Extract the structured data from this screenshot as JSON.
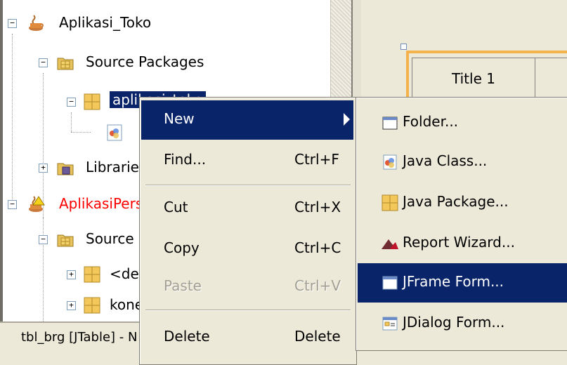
{
  "tree": {
    "items": [
      {
        "label": "Aplikasi_Toko",
        "expander": "−"
      },
      {
        "label": "Source Packages",
        "expander": "−"
      },
      {
        "label": "aplikasi_toko",
        "expander": "−"
      },
      {
        "label": "",
        "expander": ""
      },
      {
        "label": "Libraries",
        "expander": "+"
      },
      {
        "label": "AplikasiPerse",
        "expander": "−"
      },
      {
        "label": "Source F",
        "expander": "−"
      },
      {
        "label": "<de",
        "expander": "+"
      },
      {
        "label": "kone",
        "expander": "+"
      }
    ]
  },
  "status_text": "tbl_brg [JTable] - N",
  "design": {
    "table_header_title": "Title 1"
  },
  "context_menu": {
    "items": [
      {
        "label": "New",
        "shortcut": ""
      },
      {
        "label": "Find...",
        "shortcut": "Ctrl+F"
      },
      {
        "label": "Cut",
        "shortcut": "Ctrl+X"
      },
      {
        "label": "Copy",
        "shortcut": "Ctrl+C"
      },
      {
        "label": "Paste",
        "shortcut": "Ctrl+V"
      },
      {
        "label": "Delete",
        "shortcut": "Delete"
      }
    ]
  },
  "submenu": {
    "items": [
      {
        "label": "Folder...",
        "icon": "folder-icon"
      },
      {
        "label": "Java Class...",
        "icon": "java-class-icon"
      },
      {
        "label": "Java Package...",
        "icon": "java-package-icon"
      },
      {
        "label": "Report Wizard...",
        "icon": "report-wizard-icon"
      },
      {
        "label": "JFrame Form...",
        "icon": "jframe-form-icon"
      },
      {
        "label": "JDialog Form...",
        "icon": "jdialog-form-icon"
      }
    ]
  },
  "colors": {
    "selection": "#0a246a",
    "menu_bg": "#ece9d8",
    "project_error_text": "#ff0000",
    "form_frame": "#f3b24c"
  }
}
